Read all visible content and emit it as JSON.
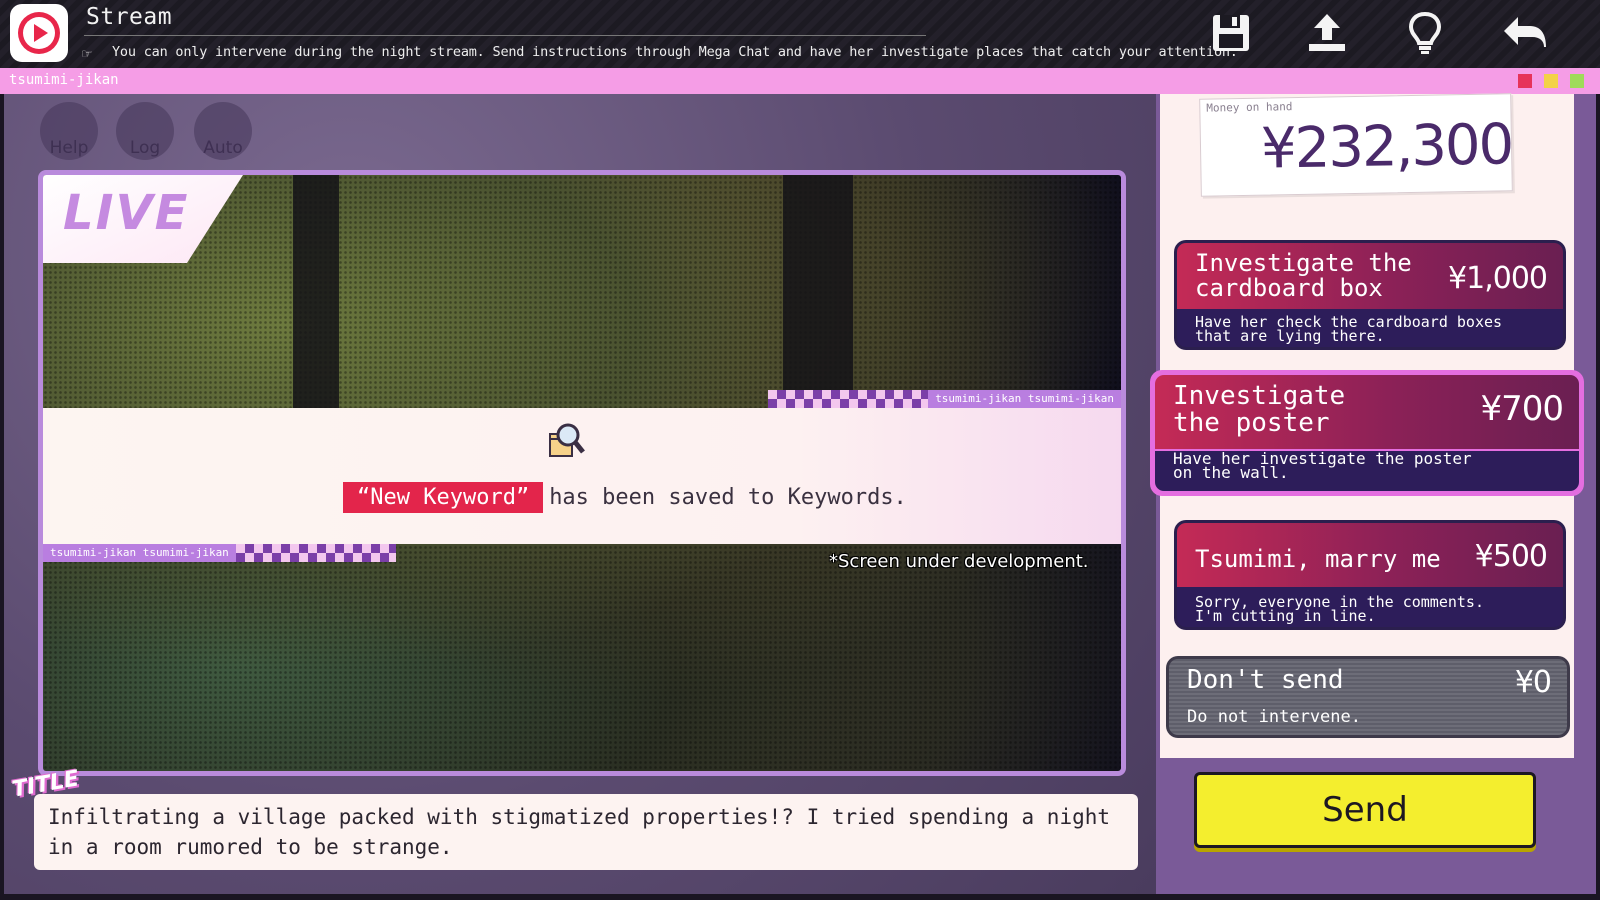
{
  "topbar": {
    "title": "Stream",
    "hint": "You can only intervene during the night stream. Send instructions through Mega Chat and have her investigate places that catch your attention.",
    "icons": [
      "play-icon",
      "hand-pointer-icon",
      "save-icon",
      "upload-icon",
      "lightbulb-icon",
      "back-arrow-icon"
    ]
  },
  "window": {
    "label": "tsumimi-jikan"
  },
  "stage": {
    "buttons": {
      "help": "Help",
      "log": "Log",
      "auto": "Auto"
    },
    "live_badge": "LIVE",
    "notice": {
      "ticker": "tsumimi-jikan tsumimi-jikan",
      "keyword": "“New Keyword”",
      "message": "has been saved to Keywords."
    },
    "dev_note": "*Screen under development.",
    "title_tag": "TITLE",
    "caption": "Infiltrating a village packed with stigmatized properties!? I tried spending a night in a room rumored to be strange."
  },
  "side": {
    "money_label": "Money on hand",
    "money_value": "¥232,300",
    "choices": [
      {
        "label": "Investigate the cardboard box",
        "price": "¥1,000",
        "desc": "Have her check the cardboard boxes that are lying there."
      },
      {
        "label": "Investigate the poster",
        "price": "¥700",
        "desc": "Have her investigate the poster on the wall."
      },
      {
        "label": "Tsumimi, marry me",
        "price": "¥500",
        "desc": "Sorry, everyone in the comments. I'm cutting in line."
      },
      {
        "label": "Don't send",
        "price": "¥0",
        "desc": "Do not intervene."
      }
    ],
    "send_label": "Send"
  },
  "colors": {
    "accent_pink": "#f59de6",
    "keyword_red": "#e3254b",
    "send_yellow": "#f4ee2e",
    "choice_selected_border": "#e46ee0"
  }
}
